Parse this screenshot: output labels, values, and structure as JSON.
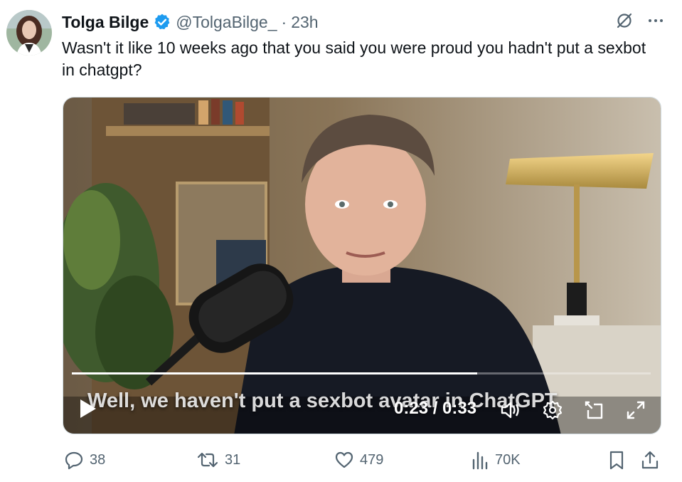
{
  "author": {
    "name": "Tolga Bilge",
    "handle": "@TolgaBilge_",
    "separator": "·",
    "time": "23h"
  },
  "tweet": {
    "text": "Wasn't it like 10 weeks ago that you said you were proud you hadn't put a sexbot in chatgpt?"
  },
  "video": {
    "caption": "Well, we haven't put a sexbot avatar in ChatGPT",
    "time_display": "0:23 / 0:33",
    "progress": 0.7
  },
  "actions": {
    "replies": "38",
    "reposts": "31",
    "likes": "479",
    "views": "70K"
  },
  "icons": [
    "verified-icon",
    "grok-icon",
    "more-icon",
    "play-icon",
    "volume-icon",
    "settings-icon",
    "pip-icon",
    "fullscreen-icon",
    "reply-icon",
    "repost-icon",
    "like-icon",
    "views-icon",
    "bookmark-icon",
    "share-icon"
  ],
  "colors": {
    "verified_blue": "#1d9bf0",
    "secondary_text": "#536471",
    "primary_text": "#0f1419"
  }
}
